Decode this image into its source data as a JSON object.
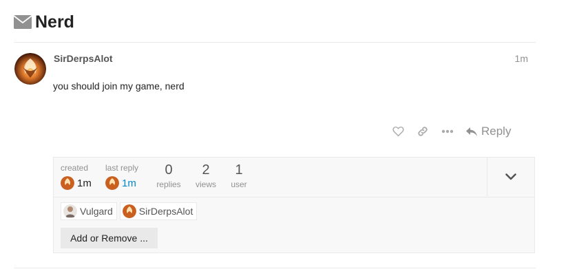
{
  "topic": {
    "title": "Nerd",
    "icon": "envelope-icon"
  },
  "post": {
    "username": "SirDerpsAlot",
    "date": "1m",
    "body": "you should join my game, nerd",
    "avatar": "phoenix-avatar",
    "actions": {
      "like": "heart-icon",
      "share": "link-icon",
      "more": "ellipsis-icon",
      "reply_label": "Reply"
    }
  },
  "topic_map": {
    "created_label": "created",
    "created_value": "1m",
    "last_reply_label": "last reply",
    "last_reply_value": "1m",
    "stats": [
      {
        "num": "0",
        "label": "replies"
      },
      {
        "num": "2",
        "label": "views"
      },
      {
        "num": "1",
        "label": "user"
      }
    ],
    "participants": [
      {
        "name": "Vulgard",
        "avatar": "vulgard-avatar"
      },
      {
        "name": "SirDerpsAlot",
        "avatar": "phoenix-avatar"
      }
    ],
    "add_remove_label": "Add or Remove ..."
  },
  "colors": {
    "link": "#0088cc",
    "muted": "#919191",
    "map_bg": "#f8f8f8",
    "avatar_orange": "#d2691e"
  }
}
